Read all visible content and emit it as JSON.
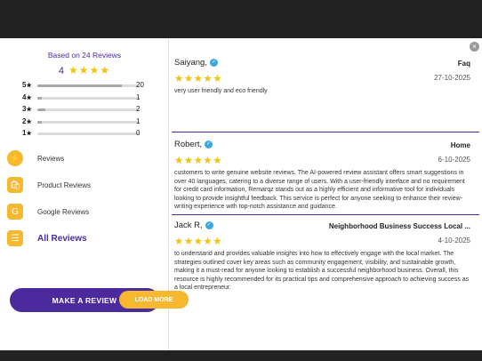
{
  "summary": {
    "based_on": "Based on 24 Reviews",
    "average": "4",
    "average_stars": "★★★★"
  },
  "distribution": [
    {
      "label": "5",
      "star": "★",
      "count": "20",
      "fraction": 0.83
    },
    {
      "label": "4",
      "star": "★",
      "count": "1",
      "fraction": 0.04
    },
    {
      "label": "3",
      "star": "★",
      "count": "2",
      "fraction": 0.08
    },
    {
      "label": "2",
      "star": "★",
      "count": "1",
      "fraction": 0.04
    },
    {
      "label": "1",
      "star": "★",
      "count": "0",
      "fraction": 0.0
    }
  ],
  "menu": [
    {
      "label": "Reviews",
      "icon": "lightning-icon",
      "glyph": "⚡"
    },
    {
      "label": "Product Reviews",
      "icon": "shopping-bag-icon",
      "glyph": "🛍"
    },
    {
      "label": "Google Reviews",
      "icon": "google-icon",
      "glyph": "G"
    },
    {
      "label": "All Reviews",
      "icon": "all-reviews-icon",
      "glyph": "☰",
      "active": true
    }
  ],
  "cta_label": "MAKE A REVIEW",
  "close_glyph": "×",
  "verified_glyph": "✓",
  "reviews": [
    {
      "name": "Saiyang,",
      "source": "Faq",
      "stars": "★★★★★",
      "date": "27-10-2025",
      "text": "very user friendly and eco friendly"
    },
    {
      "name": "Robert,",
      "source": "Home",
      "stars": "★★★★★",
      "date": "6-10-2025",
      "text": "customers to write genuine website reviews. The AI-powered review assistant offers smart suggestions in over 40 languages, catering to a diverse range of users. With a user-friendly interface and no requirement for credit card information, Remarqz stands out as a highly efficient and informative tool for individuals looking to provide insightful feedback. This service is perfect for anyone seeking to enhance their review-writing experience with top-notch assistance and guidance."
    },
    {
      "name": "Jack R,",
      "source": "Neighborhood Business Success Local ...",
      "stars": "★★★★★",
      "date": "4-10-2025",
      "text": "to understand and provides valuable insights into how to effectively engage with the local market. The strategies outlined cover key areas such as community engagement, visibility, and sustainable growth, making it a must-read for anyone looking to establish a successful neighborhood business. Overall, this resource is highly recommended for its practical tips and comprehensive approach to achieving success as a local entrepreneur."
    }
  ],
  "load_more_label": "LOAD MORE",
  "colors": {
    "accent": "#4b2a9e",
    "star": "#f1c40f",
    "button_secondary": "#f5b82e",
    "verified": "#3ba7e0"
  }
}
